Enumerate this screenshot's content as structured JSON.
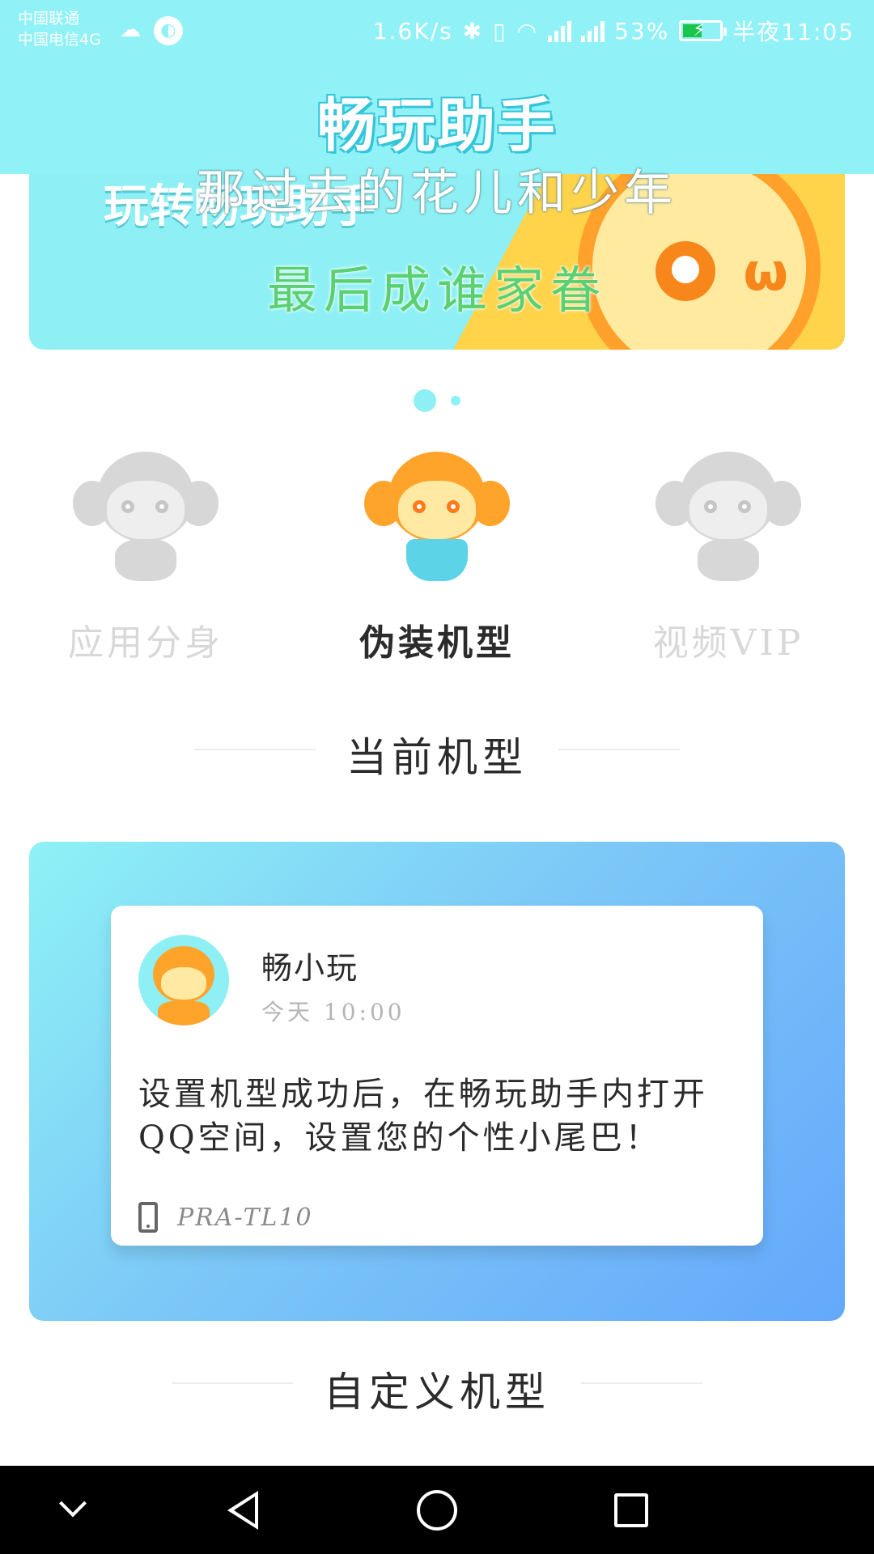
{
  "status_bar": {
    "carrier_1": "中国联通",
    "carrier_2": "中国电信4G",
    "speed": "1.6K/s",
    "battery_percent": "53%",
    "time": "半夜11:05",
    "battery_level": 0.53,
    "icons": [
      "weather-icon",
      "nfc-icon",
      "bluetooth-icon",
      "vibrate-icon",
      "wifi-icon",
      "signal-icon",
      "battery-icon"
    ]
  },
  "header": {
    "app_title": "畅玩助手"
  },
  "banner": {
    "headline": "玩转畅玩助手",
    "overlay_line_1": "那过去的花儿和少年",
    "overlay_line_2": "最后成谁家眷",
    "colors": {
      "background": "#8ef0f5",
      "accent": "#ffd34a",
      "overlay_green": "#5ad170"
    }
  },
  "carousel": {
    "page_count": 2,
    "active_index": 0
  },
  "features": [
    {
      "label": "应用分身",
      "state": "inactive",
      "icon": "monkey-twin-phones-icon"
    },
    {
      "label": "伪装机型",
      "state": "active",
      "icon": "monkey-disguise-icon"
    },
    {
      "label": "视频VIP",
      "state": "inactive",
      "icon": "monkey-vip-icon"
    }
  ],
  "sections": {
    "current_model_title": "当前机型",
    "custom_model_title": "自定义机型"
  },
  "preview_post": {
    "author": "畅小玩",
    "time": "今天 10:00",
    "content": "设置机型成功后，在畅玩助手内打开QQ空间，设置您的个性小尾巴！",
    "device_model": "PRA-TL10"
  },
  "nav_bar": {
    "icons": [
      "collapse-icon",
      "back-icon",
      "home-icon",
      "recent-apps-icon"
    ]
  }
}
